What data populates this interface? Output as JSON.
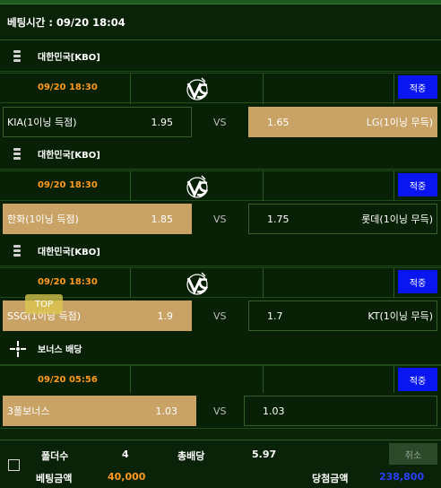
{
  "header": {
    "betting_time_label": "베팅시간 : 09/20 18:04"
  },
  "games": [
    {
      "league": "대한민국[KBO]",
      "time": "09/20 18:30",
      "apply_label": "적중",
      "home": {
        "team": "KIA(1이닝 득점)",
        "odds": "1.95",
        "selected": false
      },
      "vs": "VS",
      "away": {
        "team": "LG(1이닝 무득)",
        "odds": "1.65",
        "selected": true
      }
    },
    {
      "league": "대한민국[KBO]",
      "time": "09/20 18:30",
      "apply_label": "적중",
      "home": {
        "team": "한화(1이닝 득점)",
        "odds": "1.85",
        "selected": true
      },
      "vs": "VS",
      "away": {
        "team": "롯데(1이닝 무득)",
        "odds": "1.75",
        "selected": false
      }
    },
    {
      "league": "대한민국[KBO]",
      "time": "09/20 18:30",
      "apply_label": "적중",
      "home": {
        "team": "SSG(1이닝 득점)",
        "odds": "1.9",
        "selected": true
      },
      "vs": "VS",
      "away": {
        "team": "KT(1이닝 무득)",
        "odds": "1.7",
        "selected": false
      }
    }
  ],
  "bonus": {
    "league": "보너스 배당",
    "time": "09/20 05:56",
    "apply_label": "적중",
    "home": {
      "team": "3폴보너스",
      "odds": "1.03",
      "selected": true
    },
    "vs": "VS",
    "away": {
      "odds": "1.03"
    }
  },
  "top_badge": "TOP",
  "footer": {
    "folder_count_label": "폴더수",
    "folder_count": "4",
    "total_odds_label": "총배당",
    "total_odds": "5.97",
    "cancel_label": "취소",
    "bet_amount_label": "베팅금액",
    "bet_amount": "40,000",
    "win_amount_label": "당첨금액",
    "win_amount": "238,800"
  },
  "colors": {
    "background": "#0b2408",
    "selected_cell": "#c9a265",
    "time_text": "#ff9a20",
    "apply_button": "#0a16f0",
    "bet_amount": "#ff9a20",
    "win_amount": "#2a40ff"
  }
}
